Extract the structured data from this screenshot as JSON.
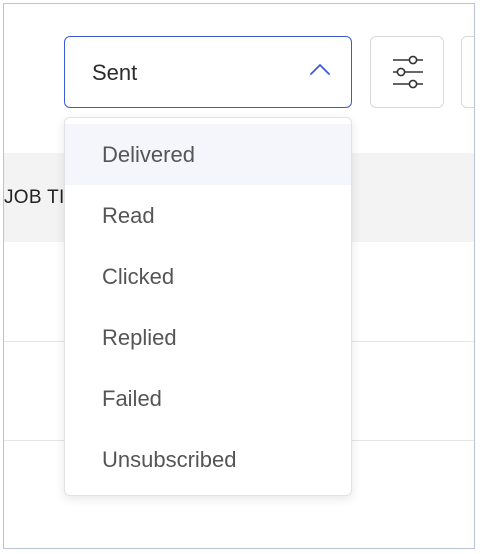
{
  "table": {
    "header_text": "JOB TI"
  },
  "filter": {
    "selected": "Sent",
    "options": [
      {
        "label": "Delivered"
      },
      {
        "label": "Read"
      },
      {
        "label": "Clicked"
      },
      {
        "label": "Replied"
      },
      {
        "label": "Failed"
      },
      {
        "label": "Unsubscribed"
      }
    ]
  },
  "icons": {
    "dropdown_toggle": "chevron-up-icon",
    "filter_button": "sliders-icon"
  },
  "colors": {
    "accent": "#3b5bdb",
    "hover_bg": "#f4f6fb",
    "header_bg": "#f3f3f3"
  }
}
